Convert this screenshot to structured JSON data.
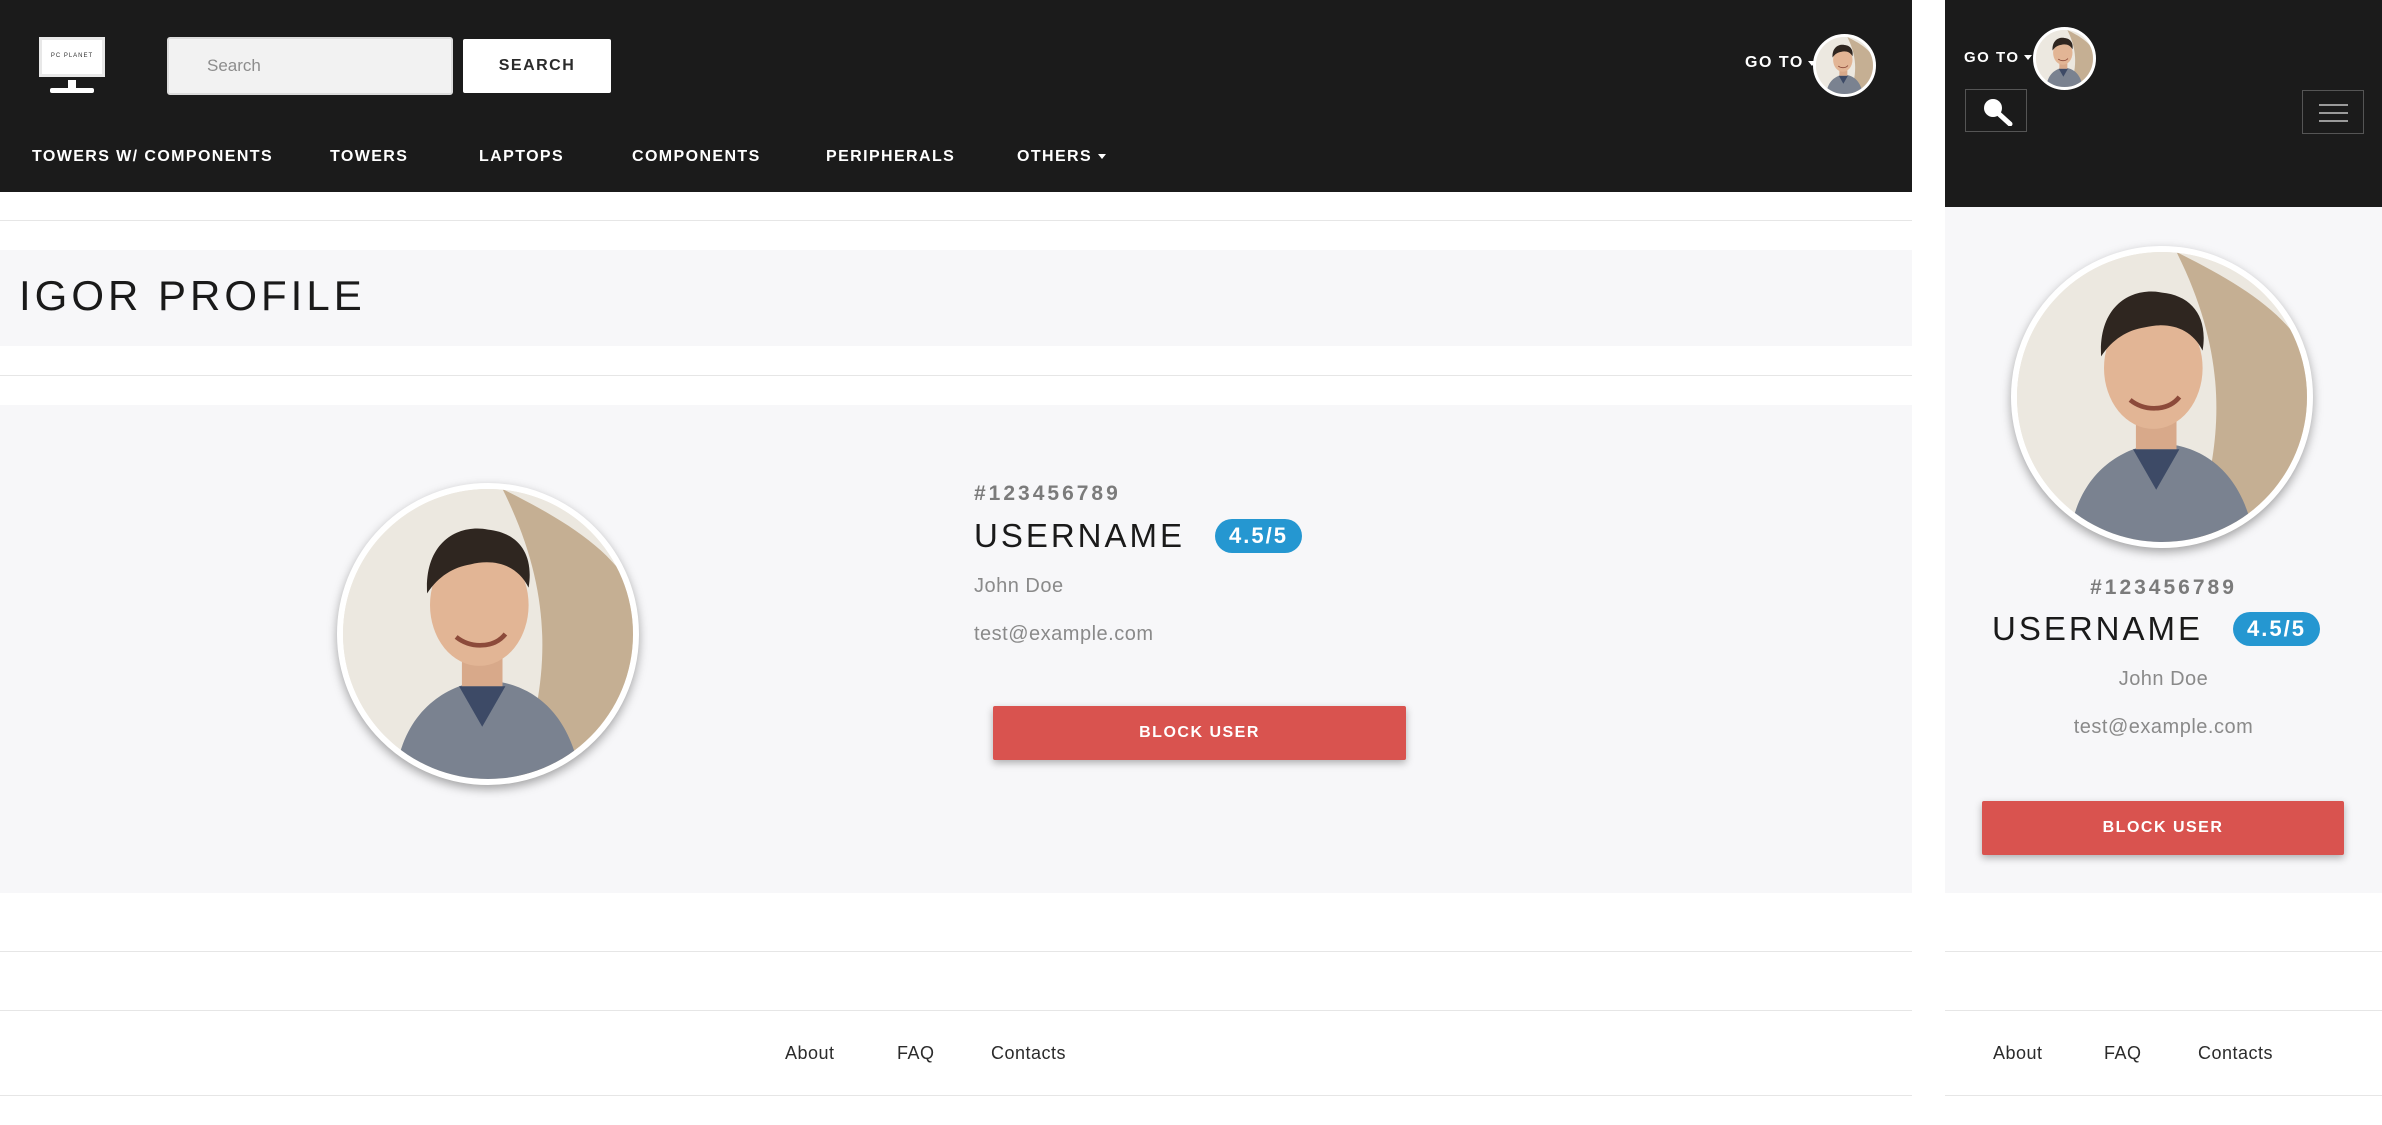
{
  "header": {
    "logo_text": "PC PLANET",
    "search": {
      "placeholder": "Search",
      "button_label": "SEARCH"
    },
    "goto_label": "GO TO",
    "nav": [
      {
        "label": "TOWERS W/ COMPONENTS"
      },
      {
        "label": "TOWERS"
      },
      {
        "label": "LAPTOPS"
      },
      {
        "label": "COMPONENTS"
      },
      {
        "label": "PERIPHERALS"
      },
      {
        "label": "OTHERS"
      }
    ]
  },
  "page": {
    "title": "IGOR PROFILE"
  },
  "profile": {
    "user_id": "#123456789",
    "username": "USERNAME",
    "rating": "4.5/5",
    "full_name": "John Doe",
    "email": "test@example.com",
    "block_button_label": "BLOCK USER"
  },
  "footer": {
    "links": [
      "About",
      "FAQ",
      "Contacts"
    ]
  },
  "icons": {
    "search": "magnifier-icon",
    "menu": "hamburger-menu-icon",
    "avatar": "user-avatar-photo",
    "dropdown": "caret-down-icon"
  },
  "colors": {
    "header_bg": "#1b1b1b",
    "band_bg": "#f7f7f9",
    "badge": "#2597d1",
    "danger_button": "#d9534f"
  }
}
